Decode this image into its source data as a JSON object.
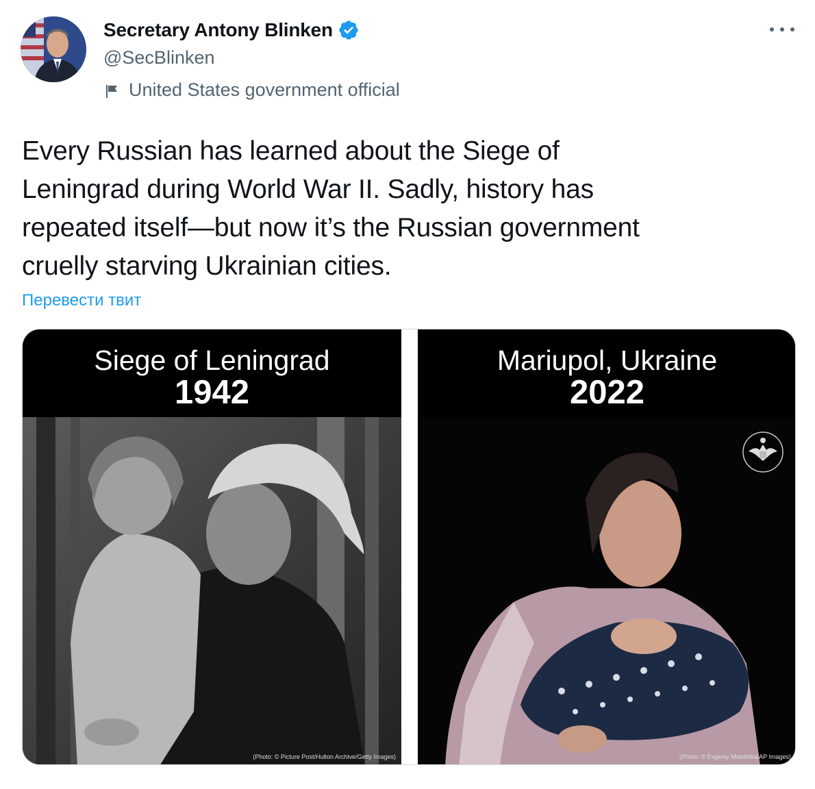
{
  "tweet": {
    "author": {
      "display_name": "Secretary Antony Blinken",
      "handle": "@SecBlinken",
      "label": "United States government official",
      "verified": true
    },
    "text": "Every Russian has learned about the Siege of\nLeningrad during World War II. Sadly, history has\nrepeated itself—but now it’s the Russian government\ncruelly starving Ukrainian cities.",
    "translate_link": "Перевести твит",
    "media": [
      {
        "place": "Siege of Leningrad",
        "year": "1942",
        "credit": "(Photo: © Picture Post/Hulton Archive/Getty Images)",
        "tone": "black-and-white"
      },
      {
        "place": "Mariupol, Ukraine",
        "year": "2022",
        "credit": "(Photo: © Evgeniy Maloletka/AP Images)",
        "tone": "color"
      }
    ]
  },
  "icons": {
    "verified": "verified-badge-icon",
    "label": "flag-icon",
    "more": "more-horizontal-icon",
    "seal": "us-state-department-seal-icon"
  },
  "colors": {
    "text": "#0f1419",
    "secondary": "#536471",
    "link": "#1d9bf0",
    "verified": "#1d9bf0",
    "panel_bg": "#000000"
  }
}
